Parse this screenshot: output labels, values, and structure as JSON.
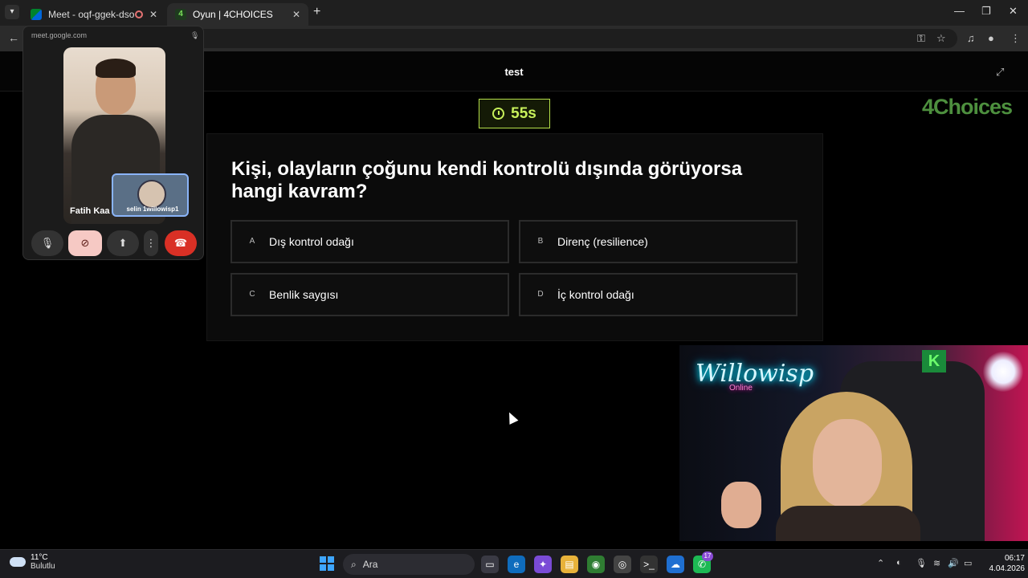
{
  "browser": {
    "tabs": [
      {
        "title": "Meet - oqf-ggek-dso",
        "recording": true
      },
      {
        "title": "Oyun | 4CHOICES",
        "favicon_text": "4"
      }
    ],
    "new_tab": "+",
    "window_controls": {
      "minimize": "—",
      "maximize": "❐",
      "close": "✕"
    }
  },
  "meet_pip": {
    "url": "meet.google.com",
    "main_participant": "Fatih Kaa",
    "self_participant": "selin 1willowisp1"
  },
  "quiz": {
    "title": "test",
    "logo": "4Choices",
    "timer": "55s",
    "question": "Kişi, olayların çoğunu kendi kontrolü dışında görüyorsa hangi kavram?",
    "answers": [
      {
        "letter": "A",
        "text": "Dış kontrol odağı"
      },
      {
        "letter": "B",
        "text": "Direnç (resilience)"
      },
      {
        "letter": "C",
        "text": "Benlik saygısı"
      },
      {
        "letter": "D",
        "text": "İç kontrol odağı"
      }
    ],
    "accent_color": "#c7f05a"
  },
  "webcam": {
    "neon_sign": "Willowisp",
    "neon_sub": "Online",
    "corner_logo": "K"
  },
  "taskbar": {
    "weather_temp": "11°C",
    "weather_desc": "Bulutlu",
    "search_placeholder": "Ara",
    "notification_badge": "17",
    "time": "06:17",
    "date": "4.04.2026"
  }
}
